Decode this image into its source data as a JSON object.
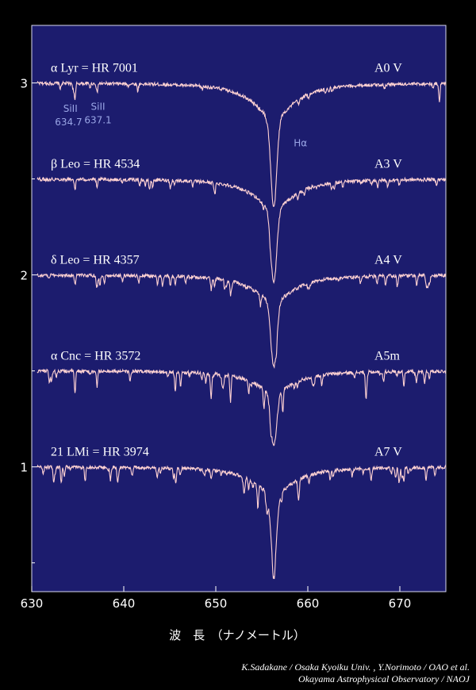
{
  "chart_data": {
    "type": "line",
    "title": "",
    "xlabel": "波　長　（ナノメートル）",
    "ylabel": "",
    "xlim": [
      630,
      675
    ],
    "ylim": [
      0.35,
      3.3
    ],
    "x_ticks": [
      630,
      640,
      650,
      660,
      670
    ],
    "y_ticks": [
      1,
      2,
      3
    ],
    "grid": false,
    "legend": "none",
    "colors": {
      "background": "#1c1c6e",
      "line": "#ffd2d2",
      "annotation": "#9aa6e6"
    },
    "series": [
      {
        "name": "α Lyr = HR 7001",
        "spectral_type": "A0 V",
        "continuum": 3.0,
        "halpha_min": 2.35,
        "features": [
          {
            "x": 634.7,
            "depth": 0.09
          },
          {
            "x": 637.1,
            "depth": 0.05
          },
          {
            "x": 674.3,
            "depth": 0.09
          }
        ]
      },
      {
        "name": "β Leo = HR 4534",
        "spectral_type": "A3 V",
        "continuum": 2.5,
        "halpha_min": 1.96,
        "features": [
          {
            "x": 634.7,
            "depth": 0.06
          },
          {
            "x": 637.1,
            "depth": 0.05
          },
          {
            "x": 642.8,
            "depth": 0.05
          },
          {
            "x": 649.9,
            "depth": 0.06
          }
        ]
      },
      {
        "name": "δ Leo = HR 4357",
        "spectral_type": "A4 V",
        "continuum": 2.0,
        "halpha_min": 1.52,
        "features": [
          {
            "x": 634.7,
            "depth": 0.05
          },
          {
            "x": 645.6,
            "depth": 0.04
          },
          {
            "x": 649.5,
            "depth": 0.06
          },
          {
            "x": 651.6,
            "depth": 0.07
          }
        ]
      },
      {
        "name": "α Cnc = HR 3572",
        "spectral_type": "A5m",
        "continuum": 1.5,
        "halpha_min": 1.11,
        "features": [
          {
            "x": 634.7,
            "depth": 0.12
          },
          {
            "x": 637.1,
            "depth": 0.08
          },
          {
            "x": 645.6,
            "depth": 0.1
          },
          {
            "x": 649.5,
            "depth": 0.12
          },
          {
            "x": 651.6,
            "depth": 0.14
          }
        ]
      },
      {
        "name": "21 LMi = HR 3974",
        "spectral_type": "A7 V",
        "continuum": 1.0,
        "halpha_min": 0.5,
        "features": [
          {
            "x": 645.6,
            "depth": 0.03
          },
          {
            "x": 649.5,
            "depth": 0.04
          }
        ]
      }
    ],
    "halpha_x": 656.3,
    "annotations": [
      {
        "text": "Hα",
        "x": 659.2,
        "y": 2.67
      },
      {
        "text": "SiII",
        "x": 634.2,
        "y": 2.85
      },
      {
        "text": "634.7",
        "x": 634.0,
        "y": 2.78
      },
      {
        "text": "SiII",
        "x": 637.2,
        "y": 2.86
      },
      {
        "text": "637.1",
        "x": 637.2,
        "y": 2.79
      }
    ]
  },
  "credit": {
    "line1": "K.Sadakane / Osaka Kyoiku Univ. , Y.Norimoto / OAO et al.",
    "line2": "Okayama Astrophysical Observatory / NAOJ"
  }
}
